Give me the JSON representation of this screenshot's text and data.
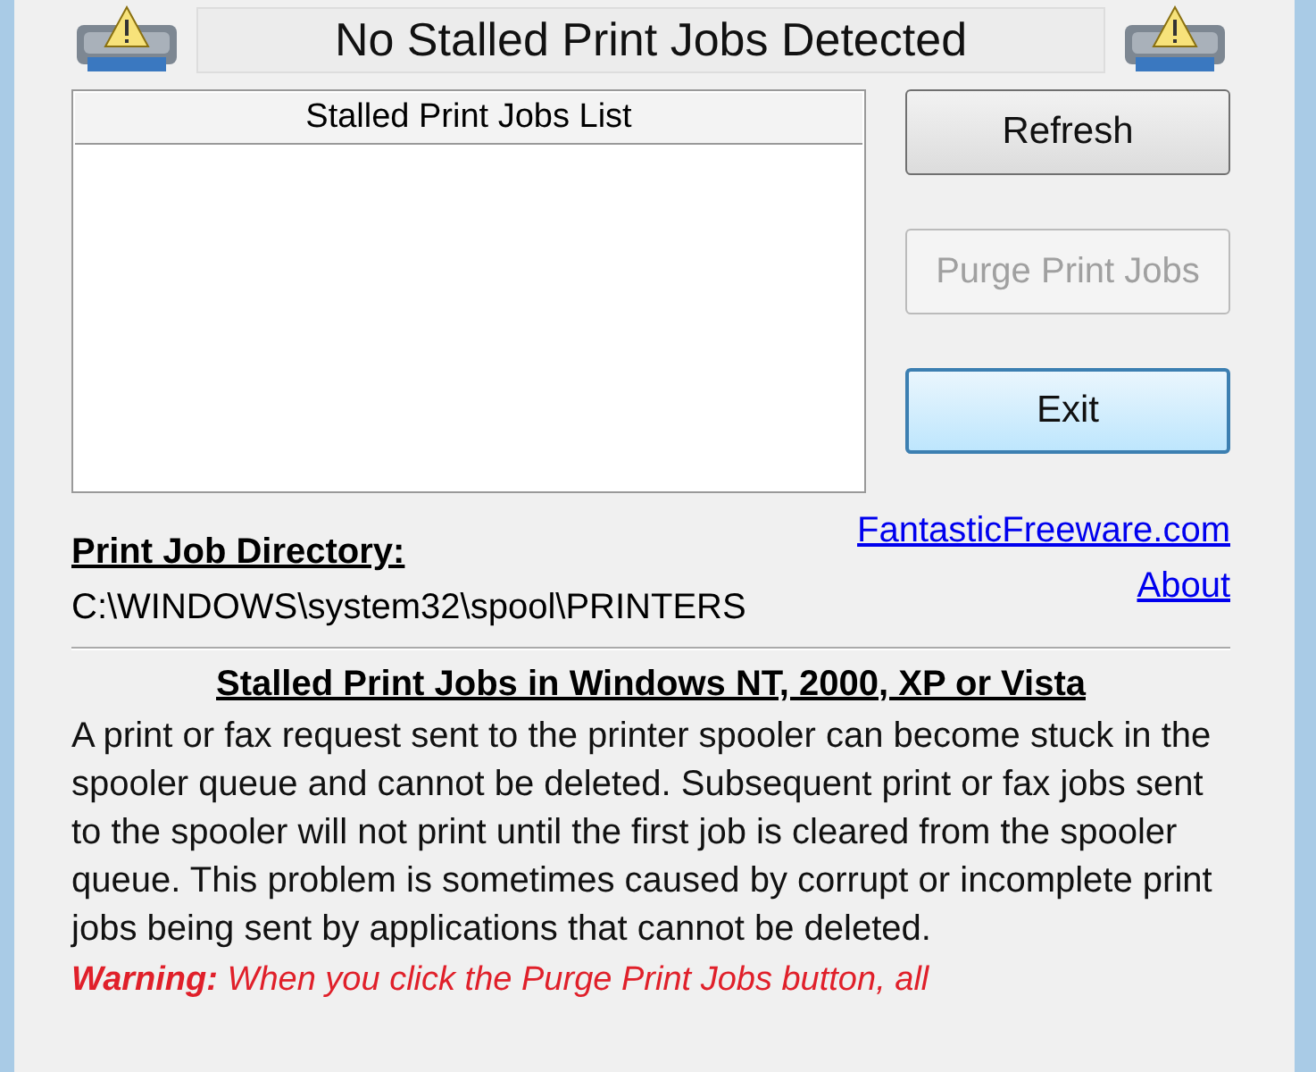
{
  "status_title": "No Stalled Print Jobs Detected",
  "job_list": {
    "header": "Stalled Print Jobs List"
  },
  "buttons": [
    {
      "label": "Refresh",
      "disabled": false,
      "default": false
    },
    {
      "label": "Purge Print Jobs",
      "disabled": true,
      "default": false
    },
    {
      "label": "Exit",
      "disabled": false,
      "default": true
    }
  ],
  "directory": {
    "label": "Print Job Directory:",
    "path": "C:\\WINDOWS\\system32\\spool\\PRINTERS"
  },
  "links": [
    "FantasticFreeware.com",
    "About"
  ],
  "info": {
    "heading": "Stalled Print Jobs in Windows NT, 2000, XP or Vista",
    "text": "A print or fax request sent to the printer spooler can become stuck in the spooler queue and cannot be deleted. Subsequent print or fax jobs sent to the spooler will not print until the first job is cleared from the spooler queue. This problem is sometimes caused by corrupt or incomplete print jobs being sent by applications that cannot be deleted.",
    "warning": "**Warning:** When you click the Purge Print Jobs button, all"
  }
}
